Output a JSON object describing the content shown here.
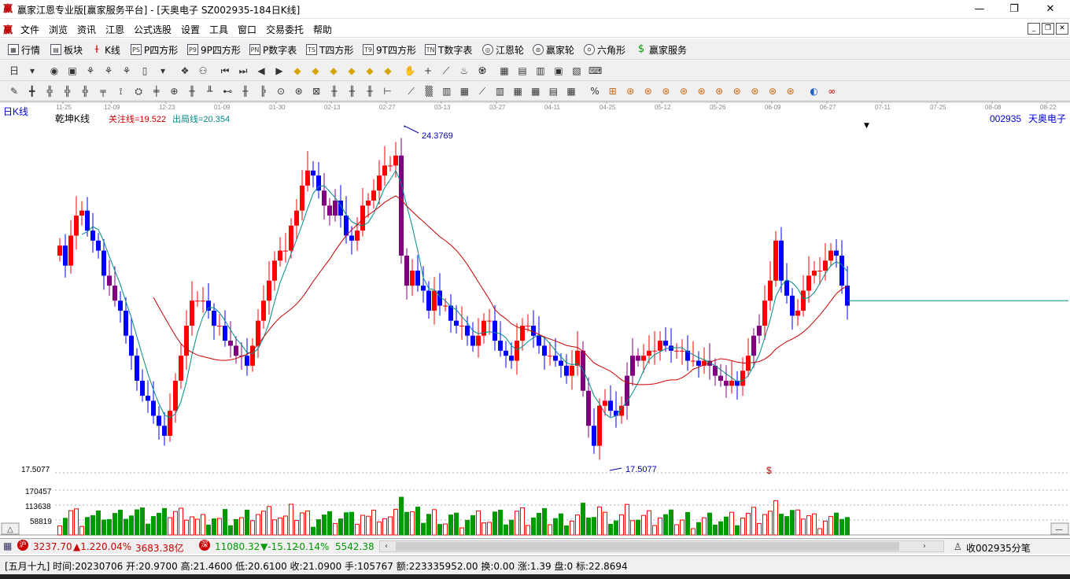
{
  "window": {
    "title": "赢家江恩专业版[赢家服务平台] - [天奥电子  SZ002935-184日K线]",
    "logo_glyph": "赢",
    "min_glyph": "—",
    "max_glyph": "❐",
    "close_glyph": "✕"
  },
  "menu": [
    "文件",
    "浏览",
    "资讯",
    "江恩",
    "公式选股",
    "设置",
    "工具",
    "窗口",
    "交易委托",
    "帮助"
  ],
  "toolbar1": [
    {
      "icon": "quote-icon",
      "label": "行情"
    },
    {
      "icon": "sector-icon",
      "label": "板块"
    },
    {
      "icon": "kline-icon",
      "label": "K线"
    },
    {
      "icon": "ps-icon",
      "label": "P四方形",
      "badge": "PS"
    },
    {
      "icon": "p9-icon",
      "label": "9P四方形",
      "badge": "P9"
    },
    {
      "icon": "pn-icon",
      "label": "P数字表",
      "badge": "PN"
    },
    {
      "icon": "ts-icon",
      "label": "T四方形",
      "badge": "TS"
    },
    {
      "icon": "t9-icon",
      "label": "9T四方形",
      "badge": "T9"
    },
    {
      "icon": "tn-icon",
      "label": "T数字表",
      "badge": "TN"
    },
    {
      "icon": "gann-wheel-icon",
      "label": "江恩轮"
    },
    {
      "icon": "winner-wheel-icon",
      "label": "赢家轮"
    },
    {
      "icon": "hexagon-icon",
      "label": "六角形"
    },
    {
      "icon": "dollar-icon",
      "label": "赢家服务"
    }
  ],
  "chart_header": {
    "period_label": "日K线",
    "indicator_name": "乾坤K线",
    "focus_line": "关注线=19.522",
    "exit_line": "出局线=20.354",
    "stock_code": "002935",
    "stock_name": "天奥电子",
    "marker": "▼"
  },
  "chart_data": {
    "type": "candlestick",
    "date_ticks": [
      "11-25",
      "12-09",
      "12-23",
      "01-09",
      "01-30",
      "02-13",
      "02-27",
      "03-13",
      "03-27",
      "04-11",
      "04-25",
      "05-12",
      "05-26",
      "06-09",
      "06-27",
      "07-11",
      "07-25",
      "08-08",
      "08-22"
    ],
    "price_axis": {
      "max_label": "24.3769",
      "min_label": "17.5077",
      "left_label": "17.5077"
    },
    "high_annotation": "24.3769",
    "low_annotation": "17.5077",
    "dollar_marker": "$",
    "volume_axis_labels": [
      "170457",
      "113638",
      "58819"
    ],
    "colors": {
      "up": "#ff0000",
      "down": "#0000ff",
      "neutral": "#800080",
      "volume_up": "#009900",
      "ma_short": "#008b8b",
      "ma_long": "#cc0000",
      "ref_line": "#008b8b"
    },
    "note_ylim": [
      17.2,
      24.6
    ]
  },
  "status1": {
    "sh_value": "3237.70",
    "sh_change": "▲1.22",
    "sh_pct": "0.04%",
    "sh_amount": "3683.38亿",
    "sz_value": "11080.32",
    "sz_change": "▼-15.12",
    "sz_pct": "-0.14%",
    "sz_amount": "5542.38",
    "right_label": "收002935分笔",
    "scroll_left": "‹",
    "scroll_right": "›"
  },
  "status2": {
    "text": "[五月十九] 时间:20230706 开:20.9700 高:21.4600 低:20.6100 收:21.0900 手:105767 额:223335952.00 换:0.00 涨:1.39 盘:0 标:22.8694"
  }
}
